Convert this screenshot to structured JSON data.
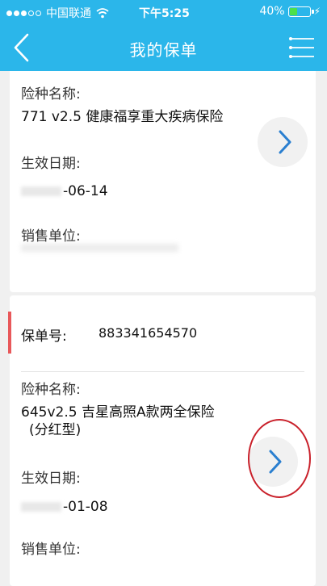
{
  "status_bar": {
    "carrier": "中国联通",
    "signal_bars_filled": 3,
    "signal_bars_total": 5,
    "time": "下午5:25",
    "battery_percent": "40%",
    "battery_level": 0.4,
    "battery_color": "#4ce04a"
  },
  "nav": {
    "title": "我的保单"
  },
  "colors": {
    "header": "#2bb6ea",
    "marker": "#e8585a",
    "highlight": "#c9202a"
  },
  "policies": [
    {
      "type_label": "险种名称:",
      "type_value": "771 v2.5 健康福享重大疾病保险",
      "effective_label": "生效日期:",
      "effective_value": "-06-14",
      "unit_label": "销售单位:"
    },
    {
      "policy_no_label": "保单号:",
      "policy_no_value": "883341654570",
      "type_label": "险种名称:",
      "type_value_line1": "645v2.5 吉星高照A款两全保险",
      "type_value_line2": "(分红型)",
      "effective_label": "生效日期:",
      "effective_value": "-01-08",
      "unit_label": "销售单位:"
    }
  ]
}
